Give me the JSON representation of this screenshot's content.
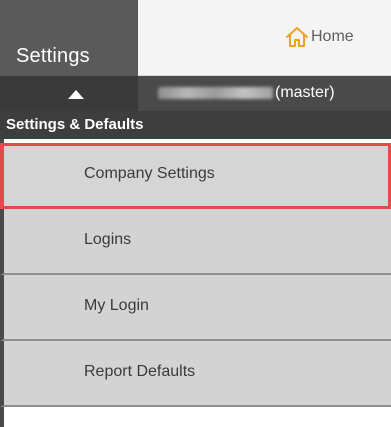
{
  "header": {
    "settings_tab_label": "Settings",
    "home_label": "Home",
    "account_suffix": "(master)",
    "icons": {
      "home": "home-icon",
      "caret": "caret-up-icon"
    }
  },
  "section": {
    "title": "Settings & Defaults"
  },
  "menu": {
    "items": [
      {
        "label": "Company Settings"
      },
      {
        "label": "Logins"
      },
      {
        "label": "My Login"
      },
      {
        "label": "Report Defaults"
      }
    ]
  },
  "colors": {
    "active_outline": "#e14b4b",
    "home_icon": "#f0a020"
  }
}
